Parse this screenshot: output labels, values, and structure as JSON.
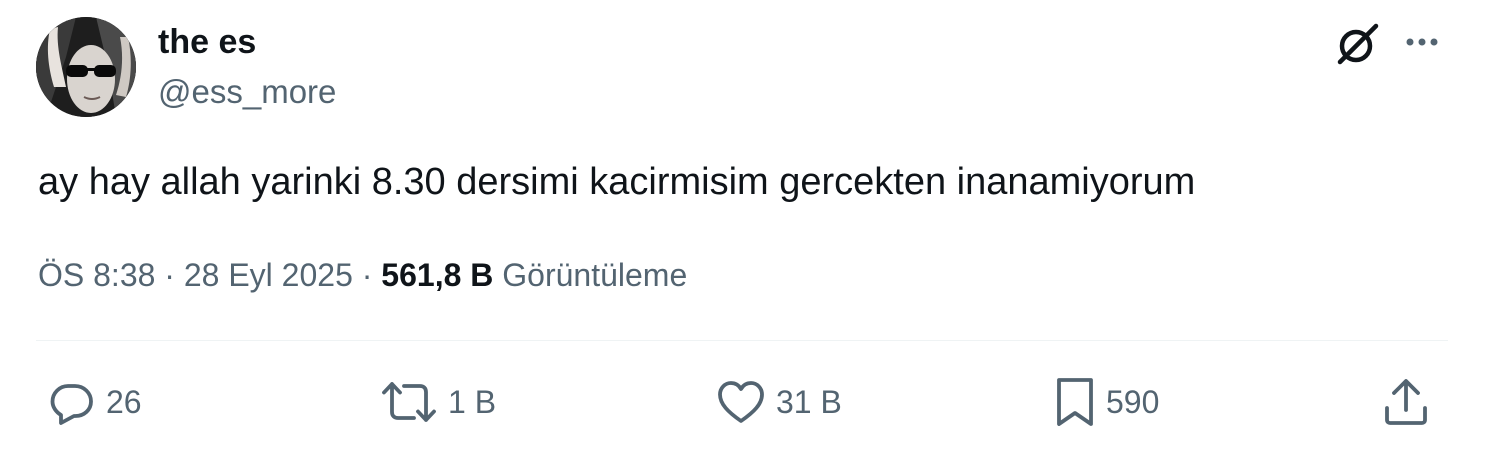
{
  "author": {
    "display_name": "the es",
    "handle": "@ess_more"
  },
  "tweet": {
    "text": "ay hay allah yarinki 8.30 dersimi kacirmisim gercekten inanamiyorum"
  },
  "meta": {
    "time": "ÖS 8:38",
    "separator": "·",
    "date": "28 Eyl 2025",
    "views_count": "561,8 B",
    "views_label": "Görüntüleme"
  },
  "actions": {
    "reply_count": "26",
    "retweet_count": "1 B",
    "like_count": "31 B",
    "bookmark_count": "590"
  },
  "icons": {
    "grok": "grok-icon",
    "more": "more-icon",
    "reply": "reply-icon",
    "retweet": "retweet-icon",
    "like": "heart-icon",
    "bookmark": "bookmark-icon",
    "share": "share-icon"
  },
  "colors": {
    "text_primary": "#0f1419",
    "text_secondary": "#536471",
    "divider": "#eff3f4"
  }
}
